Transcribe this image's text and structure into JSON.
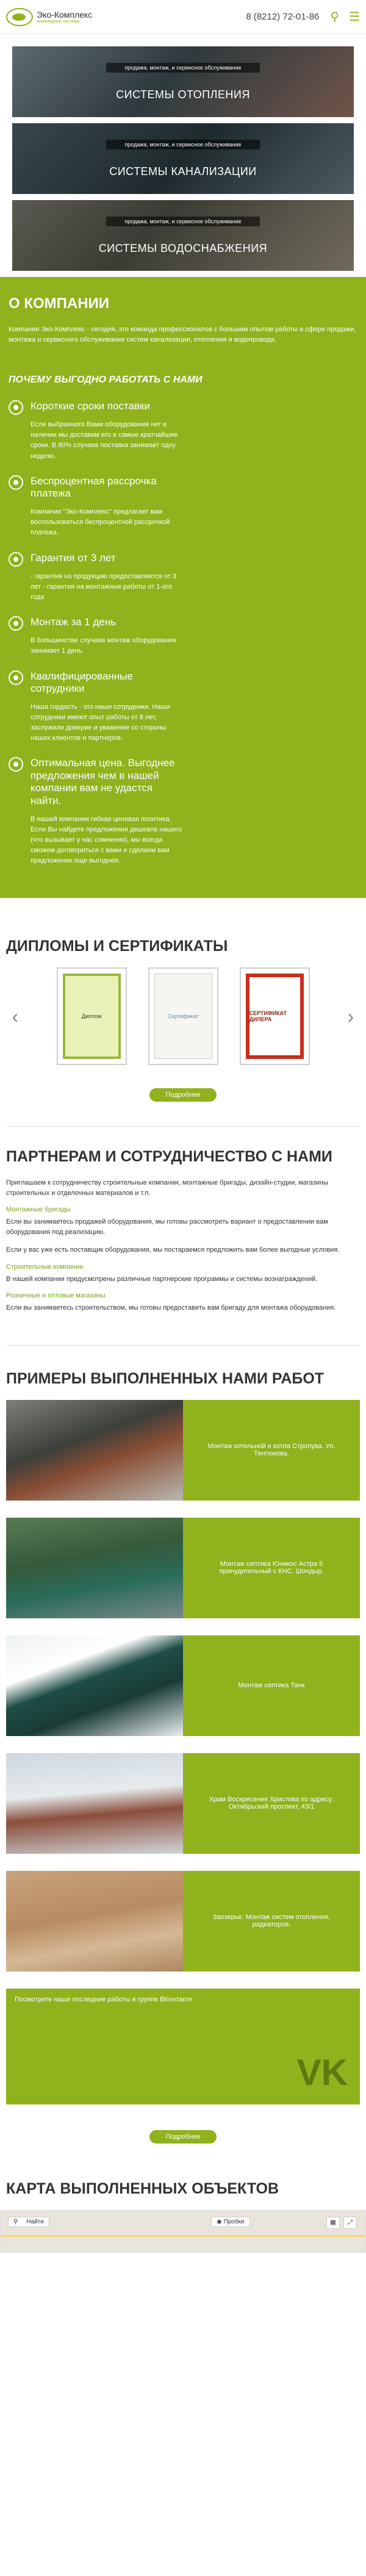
{
  "header": {
    "logo_name": "Эко-Комплекс",
    "logo_tagline": "инженерные системы",
    "phone": "8 (8212) 72-01-86",
    "icons": [
      "search-icon",
      "menu-icon"
    ]
  },
  "banners": [
    {
      "band": "продажа, монтаж, и сервисное обслуживание",
      "title": "СИСТЕМЫ ОТОПЛЕНИЯ"
    },
    {
      "band": "продажа, монтаж, и сервисное обслуживание",
      "title": "СИСТЕМЫ КАНАЛИЗАЦИИ"
    },
    {
      "band": "продажа, монтаж, и сервисное обслуживание",
      "title": "СИСТЕМЫ ВОДОСНАБЖЕНИЯ"
    }
  ],
  "about": {
    "title": "О компании",
    "text": "Компания Эко-Комплекс - сегодня, это команда профессионалов с большим опытом работы в сфере продажи, монтажа и сервисного обслуживания систем канализации, отопления и водопровода."
  },
  "why": {
    "title": "ПОЧЕМУ ВЫГОДНО РАБОТАТЬ С НАМИ",
    "items": [
      {
        "title": "Короткие сроки поставки",
        "text": "Если выбранного Вами оборудования нет в наличии мы доставим его в самые кратчайшие сроки. В 80% случаев поставка занимает одну неделю."
      },
      {
        "title": "Беспроцентная рассрочка платежа",
        "text": "Компания \"Эко-Комплекс\" предлагает вам воспользоваться беспроцентной рассрочкой платежа."
      },
      {
        "title": "Гарантия от 3 лет",
        "text": "- гарантия на продукцию предоставляется от 3 лет - гарантия на монтажные работы от 1-ого года"
      },
      {
        "title": "Монтаж за 1 день",
        "text": "В большинстве случаев монтаж оборудования занимает 1 день."
      },
      {
        "title": "Квалифицированные сотрудники",
        "text": "Наша гордость - это наши сотрудники. Наши сотрудники имеют опыт работы от 8 лет, заслужили доверие и уважение со стороны наших клиентов и партнеров."
      },
      {
        "title": "Оптимальная цена. Выгоднее предложения чем в нашей компании вам не удастся найти.",
        "text": "В нашей компании гибкая ценовая политика. Если Вы найдете предложения дешевле нашего (что вызывает у нас сомнения), мы всегда сможем договориться с вами и сделаем вам предложение еще выгоднее."
      }
    ]
  },
  "diplomas": {
    "title": "ДИПЛОМЫ И СЕРТИФИКАТЫ",
    "items": [
      "Диплом",
      "Сертификат",
      "СЕРТИФИКАТ ДИЛЕРА"
    ],
    "more_label": "Подробнее"
  },
  "partners": {
    "title": "ПАРТНЕРАМ И СОТРУДНИЧЕСТВО С НАМИ",
    "intro": "Приглашаем к сотрудничеству строительные компании, монтажные бригады, дизайн-студии, магазины строительных и отделочных материалов и т.п.",
    "groups": [
      {
        "heading": "Монтажные бригады",
        "paragraphs": [
          "Если вы занимаетесь продажей оборудования, мы готовы рассмотреть вариант о предоставлении вам оборудования под реализацию.",
          "Если у вас уже есть поставщик оборудования, мы постараемся предложить вам более выгодные условия."
        ]
      },
      {
        "heading": "Строительные компании",
        "paragraphs": [
          "В нашей компании предусмотрены различные партнерские программы и системы вознаграждений."
        ]
      },
      {
        "heading": "Розничные и оптовые магазины",
        "paragraphs": [
          "Если вы занимаетесь строительством, мы готовы предоставить вам бригаду для монтажа оборудования."
        ]
      }
    ]
  },
  "works": {
    "title": "ПРИМЕРЫ ВЫПОЛНЕННЫХ НАМИ РАБОТ",
    "items": [
      "Монтаж котельной и котла Стропува. Ул. Тентюкова.",
      "Монтаж септика Юникос Астра 5 принудительный с КНС. Шондыр.",
      "Монтаж септика Танк",
      "Храм Воскресения Христова по адресу: Октябрьский проспект, 43/1",
      "Заозерье. Монтаж систем отопления, радиаторов."
    ],
    "vk_text": "Посмотрите наши последние работы в группе ВКонтакте",
    "vk_logo": "VK",
    "more_label": "Подробнее"
  },
  "map": {
    "title": "КАРТА ВЫПОЛНЕННЫХ ОБЪЕКТОВ",
    "search_label": "Найти",
    "traffic_label": "Пробки"
  }
}
